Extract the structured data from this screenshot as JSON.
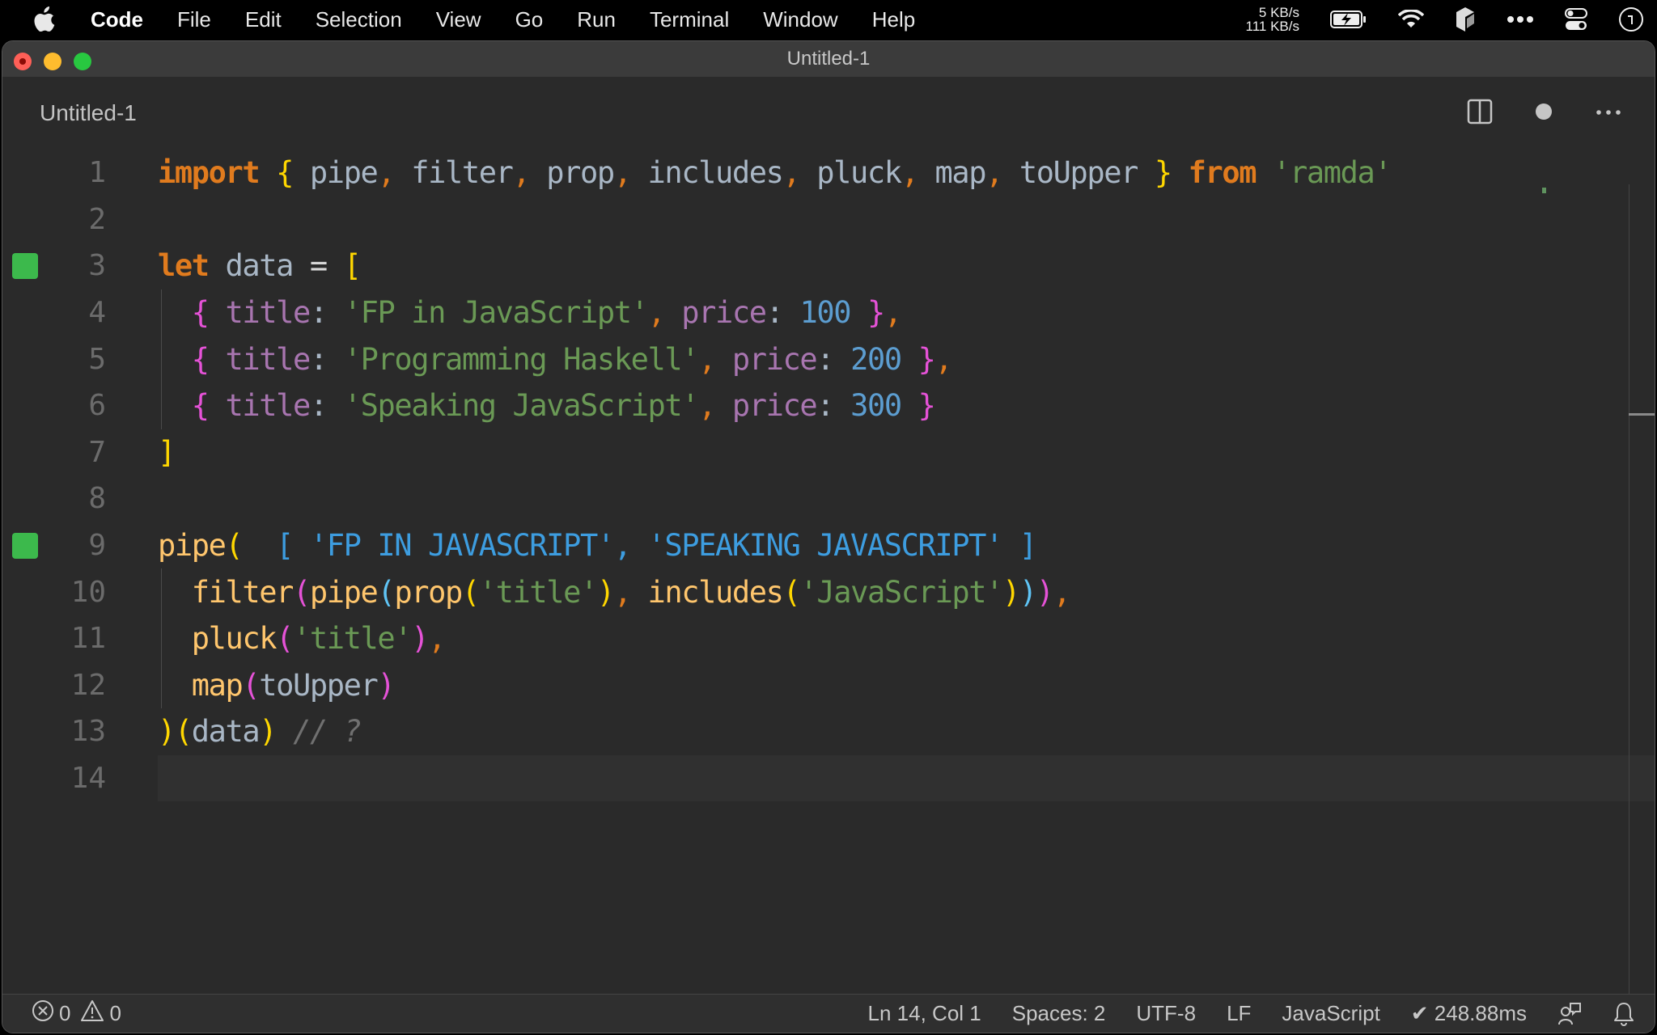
{
  "menubar": {
    "app_name": "Code",
    "items": [
      "File",
      "Edit",
      "Selection",
      "View",
      "Go",
      "Run",
      "Terminal",
      "Window",
      "Help"
    ],
    "network_up": "5 KB/s",
    "network_down": "111 KB/s",
    "icons": [
      "apple-icon",
      "battery-charging-icon",
      "wifi-icon",
      "app-status-icon",
      "more-icon",
      "control-center-icon",
      "clock-icon"
    ]
  },
  "window": {
    "title": "Untitled-1"
  },
  "tab": {
    "label": "Untitled-1",
    "actions": [
      "split-editor-icon",
      "unsaved-dot-icon",
      "more-actions-icon"
    ]
  },
  "editor": {
    "current_line": 14,
    "lines": [
      {
        "n": "1",
        "tokens": [
          [
            "kw",
            "import"
          ],
          [
            "id",
            " "
          ],
          [
            "br-y",
            "{"
          ],
          [
            "id",
            " pipe"
          ],
          [
            "punc",
            ","
          ],
          [
            "id",
            " filter"
          ],
          [
            "punc",
            ","
          ],
          [
            "id",
            " prop"
          ],
          [
            "punc",
            ","
          ],
          [
            "id",
            " includes"
          ],
          [
            "punc",
            ","
          ],
          [
            "id",
            " pluck"
          ],
          [
            "punc",
            ","
          ],
          [
            "id",
            " map"
          ],
          [
            "punc",
            ","
          ],
          [
            "id",
            " toUpper "
          ],
          [
            "br-y",
            "}"
          ],
          [
            "id",
            " "
          ],
          [
            "kw",
            "from"
          ],
          [
            "id",
            " "
          ],
          [
            "str",
            "'ramda'"
          ]
        ]
      },
      {
        "n": "2",
        "tokens": []
      },
      {
        "n": "3",
        "marker": true,
        "tokens": [
          [
            "kw",
            "let"
          ],
          [
            "id",
            " data "
          ],
          [
            "op",
            "="
          ],
          [
            "id",
            " "
          ],
          [
            "br-y",
            "["
          ]
        ]
      },
      {
        "n": "4",
        "tokens": [
          [
            "id",
            "  "
          ],
          [
            "br-p",
            "{"
          ],
          [
            "id",
            " "
          ],
          [
            "prop",
            "title"
          ],
          [
            "colon",
            ":"
          ],
          [
            "id",
            " "
          ],
          [
            "str",
            "'FP in JavaScript'"
          ],
          [
            "punc",
            ","
          ],
          [
            "id",
            " "
          ],
          [
            "prop",
            "price"
          ],
          [
            "colon",
            ":"
          ],
          [
            "id",
            " "
          ],
          [
            "num",
            "100"
          ],
          [
            "id",
            " "
          ],
          [
            "br-p",
            "}"
          ],
          [
            "punc",
            ","
          ]
        ]
      },
      {
        "n": "5",
        "tokens": [
          [
            "id",
            "  "
          ],
          [
            "br-p",
            "{"
          ],
          [
            "id",
            " "
          ],
          [
            "prop",
            "title"
          ],
          [
            "colon",
            ":"
          ],
          [
            "id",
            " "
          ],
          [
            "str",
            "'Programming Haskell'"
          ],
          [
            "punc",
            ","
          ],
          [
            "id",
            " "
          ],
          [
            "prop",
            "price"
          ],
          [
            "colon",
            ":"
          ],
          [
            "id",
            " "
          ],
          [
            "num",
            "200"
          ],
          [
            "id",
            " "
          ],
          [
            "br-p",
            "}"
          ],
          [
            "punc",
            ","
          ]
        ]
      },
      {
        "n": "6",
        "tokens": [
          [
            "id",
            "  "
          ],
          [
            "br-p",
            "{"
          ],
          [
            "id",
            " "
          ],
          [
            "prop",
            "title"
          ],
          [
            "colon",
            ":"
          ],
          [
            "id",
            " "
          ],
          [
            "str",
            "'Speaking JavaScript'"
          ],
          [
            "punc",
            ","
          ],
          [
            "id",
            " "
          ],
          [
            "prop",
            "price"
          ],
          [
            "colon",
            ":"
          ],
          [
            "id",
            " "
          ],
          [
            "num",
            "300"
          ],
          [
            "id",
            " "
          ],
          [
            "br-p",
            "}"
          ]
        ]
      },
      {
        "n": "7",
        "tokens": [
          [
            "br-y",
            "]"
          ]
        ]
      },
      {
        "n": "8",
        "tokens": []
      },
      {
        "n": "9",
        "marker": true,
        "tokens": [
          [
            "fn",
            "pipe"
          ],
          [
            "br-y",
            "("
          ],
          [
            "id",
            "  "
          ],
          [
            "result",
            "[ 'FP IN JAVASCRIPT', 'SPEAKING JAVASCRIPT' ]"
          ]
        ]
      },
      {
        "n": "10",
        "tokens": [
          [
            "id",
            "  "
          ],
          [
            "fn",
            "filter"
          ],
          [
            "br-p",
            "("
          ],
          [
            "fn",
            "pipe"
          ],
          [
            "br-b",
            "("
          ],
          [
            "fn",
            "prop"
          ],
          [
            "br-y",
            "("
          ],
          [
            "str",
            "'title'"
          ],
          [
            "br-y",
            ")"
          ],
          [
            "punc",
            ","
          ],
          [
            "id",
            " "
          ],
          [
            "fn",
            "includes"
          ],
          [
            "br-y",
            "("
          ],
          [
            "str",
            "'JavaScript'"
          ],
          [
            "br-y",
            ")"
          ],
          [
            "br-b",
            ")"
          ],
          [
            "br-p",
            ")"
          ],
          [
            "punc",
            ","
          ]
        ]
      },
      {
        "n": "11",
        "tokens": [
          [
            "id",
            "  "
          ],
          [
            "fn",
            "pluck"
          ],
          [
            "br-p",
            "("
          ],
          [
            "str",
            "'title'"
          ],
          [
            "br-p",
            ")"
          ],
          [
            "punc",
            ","
          ]
        ]
      },
      {
        "n": "12",
        "tokens": [
          [
            "id",
            "  "
          ],
          [
            "fn",
            "map"
          ],
          [
            "br-p",
            "("
          ],
          [
            "id",
            "toUpper"
          ],
          [
            "br-p",
            ")"
          ]
        ]
      },
      {
        "n": "13",
        "tokens": [
          [
            "br-y",
            ")"
          ],
          [
            "br-y",
            "("
          ],
          [
            "id",
            "data"
          ],
          [
            "br-y",
            ")"
          ],
          [
            "id",
            " "
          ],
          [
            "cmt",
            "// ?"
          ]
        ]
      },
      {
        "n": "14",
        "tokens": []
      }
    ]
  },
  "statusbar": {
    "errors": "0",
    "warnings": "0",
    "cursor": "Ln 14, Col 1",
    "indent": "Spaces: 2",
    "encoding": "UTF-8",
    "eol": "LF",
    "language": "JavaScript",
    "timing": "✔ 248.88ms"
  },
  "colors": {
    "keyword": "#e07b1e",
    "string": "#6a9955",
    "number": "#5c9dd0",
    "function": "#ffc66d",
    "property": "#a875b0",
    "result": "#3d9de0",
    "gutter_marker": "#3cb94c"
  }
}
